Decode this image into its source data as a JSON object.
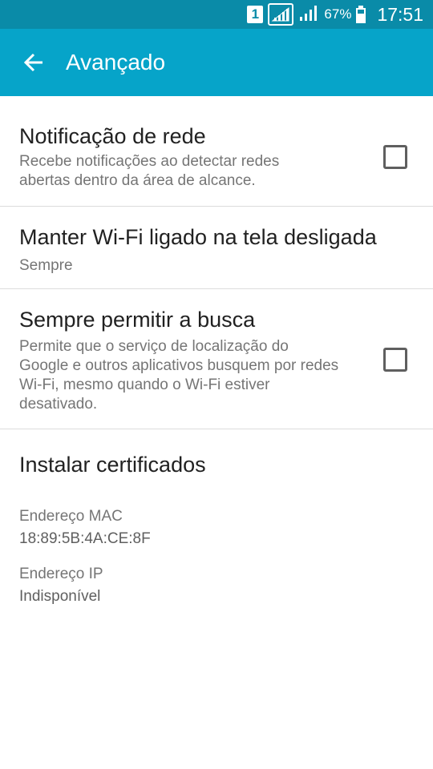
{
  "status_bar": {
    "sim_slot": "1",
    "battery_percent": "67%",
    "battery_level": 0.67,
    "time": "17:51"
  },
  "app_bar": {
    "title": "Avançado",
    "back_icon": "arrow-left-icon"
  },
  "preferences": [
    {
      "title": "Notificação de rede",
      "summary": "Recebe notificações ao detectar redes abertas dentro da área de alcance.",
      "checked": false
    },
    {
      "title": "Manter Wi-Fi ligado na tela desligada",
      "summary": "Sempre"
    },
    {
      "title": "Sempre permitir a busca",
      "summary": "Permite que o serviço de localização do Google e outros aplicativos busquem por redes Wi-Fi, mesmo quando o Wi-Fi estiver desativado.",
      "checked": false
    },
    {
      "title": "Instalar certificados"
    }
  ],
  "info": {
    "mac_label": "Endereço MAC",
    "mac_value": "18:89:5B:4A:CE:8F",
    "ip_label": "Endereço IP",
    "ip_value": "Indisponível"
  },
  "colors": {
    "status_bar": "#0a8ba8",
    "app_bar": "#06a4c9"
  }
}
